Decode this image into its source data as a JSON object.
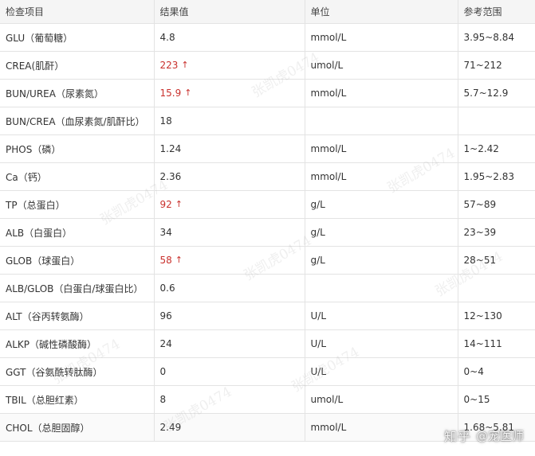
{
  "table": {
    "headers": [
      "检查项目",
      "结果值",
      "单位",
      "参考范围"
    ],
    "rows": [
      {
        "item": "GLU（葡萄糖）",
        "value": "4.8",
        "flag": "",
        "unit": "mmol/L",
        "range": "3.95~8.84"
      },
      {
        "item": "CREA(肌酐）",
        "value": "223",
        "flag": "↑",
        "unit": "umol/L",
        "range": "71~212"
      },
      {
        "item": "BUN/UREA（尿素氮）",
        "value": "15.9",
        "flag": "↑",
        "unit": "mmol/L",
        "range": "5.7~12.9"
      },
      {
        "item": "BUN/CREA（血尿素氮/肌酐比）",
        "value": "18",
        "flag": "",
        "unit": "",
        "range": ""
      },
      {
        "item": "PHOS（磷）",
        "value": "1.24",
        "flag": "",
        "unit": "mmol/L",
        "range": "1~2.42"
      },
      {
        "item": "Ca（钙）",
        "value": "2.36",
        "flag": "",
        "unit": "mmol/L",
        "range": "1.95~2.83"
      },
      {
        "item": "TP（总蛋白）",
        "value": "92",
        "flag": "↑",
        "unit": "g/L",
        "range": "57~89"
      },
      {
        "item": "ALB（白蛋白）",
        "value": "34",
        "flag": "",
        "unit": "g/L",
        "range": "23~39"
      },
      {
        "item": "GLOB（球蛋白）",
        "value": "58",
        "flag": "↑",
        "unit": "g/L",
        "range": "28~51"
      },
      {
        "item": "ALB/GLOB（白蛋白/球蛋白比）",
        "value": "0.6",
        "flag": "",
        "unit": "",
        "range": ""
      },
      {
        "item": "ALT（谷丙转氨酶）",
        "value": "96",
        "flag": "",
        "unit": "U/L",
        "range": "12~130"
      },
      {
        "item": "ALKP（碱性磷酸酶）",
        "value": "24",
        "flag": "",
        "unit": "U/L",
        "range": "14~111"
      },
      {
        "item": "GGT（谷氨酰转肽酶）",
        "value": "0",
        "flag": "",
        "unit": "U/L",
        "range": "0~4"
      },
      {
        "item": "TBIL（总胆红素）",
        "value": "8",
        "flag": "",
        "unit": "umol/L",
        "range": "0~15"
      },
      {
        "item": "CHOL（总胆固醇）",
        "value": "2.49",
        "flag": "",
        "unit": "mmol/L",
        "range": "1.68~5.81"
      }
    ]
  },
  "colors": {
    "high_value": "#c9302c",
    "header_bg": "#f5f5f5",
    "border": "#e3e3e3"
  },
  "watermark": {
    "text": "张凯虎0474"
  },
  "credit": {
    "brand": "知乎",
    "author": "@宠医师"
  }
}
